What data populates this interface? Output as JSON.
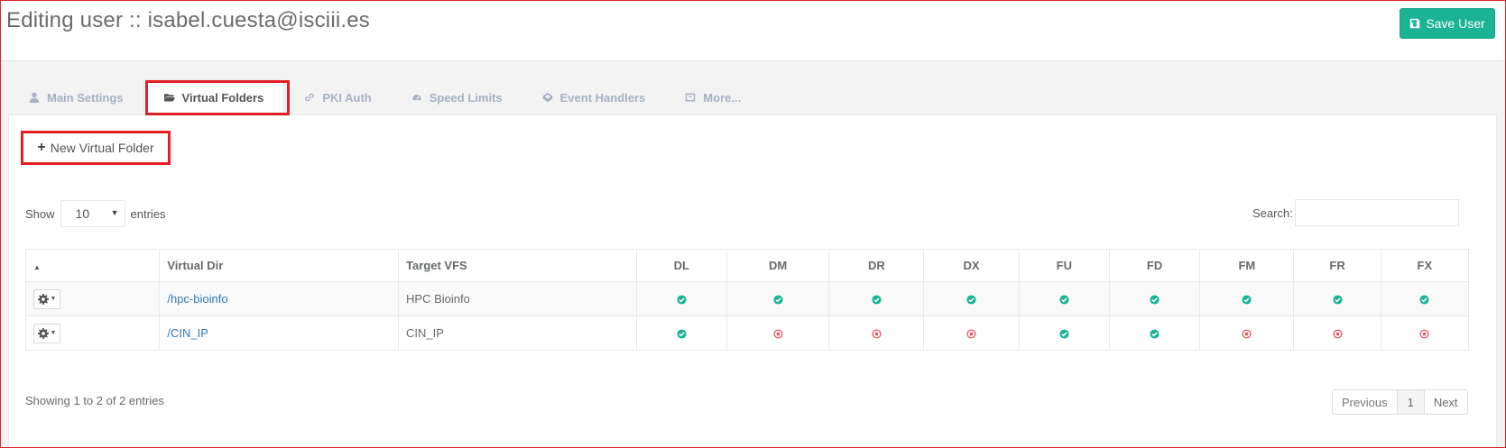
{
  "header": {
    "title": "Editing user :: isabel.cuesta@isciii.es",
    "save_label": "Save User"
  },
  "tabs": [
    {
      "label": "Main Settings",
      "icon": "user-icon"
    },
    {
      "label": "Virtual Folders",
      "icon": "folder-open-icon",
      "active": true
    },
    {
      "label": "PKI Auth",
      "icon": "link-icon"
    },
    {
      "label": "Speed Limits",
      "icon": "tachometer-icon"
    },
    {
      "label": "Event Handlers",
      "icon": "codepen-icon"
    },
    {
      "label": "More...",
      "icon": "archive-icon"
    }
  ],
  "actions": {
    "new_folder_label": "New Virtual Folder"
  },
  "length": {
    "show_label": "Show",
    "value": "10",
    "entries_label": "entries"
  },
  "search": {
    "label": "Search:",
    "placeholder": ""
  },
  "table": {
    "columns": [
      "",
      "Virtual Dir",
      "Target VFS",
      "DL",
      "DM",
      "DR",
      "DX",
      "FU",
      "FD",
      "FM",
      "FR",
      "FX"
    ],
    "rows": [
      {
        "dir": "/hpc-bioinfo",
        "vfs": "HPC Bioinfo",
        "perms": [
          true,
          true,
          true,
          true,
          true,
          true,
          true,
          true,
          true
        ]
      },
      {
        "dir": "/CIN_IP",
        "vfs": "CIN_IP",
        "perms": [
          true,
          false,
          false,
          false,
          true,
          true,
          false,
          false,
          false
        ]
      }
    ]
  },
  "footer": {
    "info": "Showing 1 to 2 of 2 entries",
    "prev_label": "Previous",
    "current_page": "1",
    "next_label": "Next"
  },
  "colors": {
    "accent": "#1ab394",
    "ok": "#1ab394",
    "denied": "#ed5565",
    "highlight": "#e01f26"
  }
}
